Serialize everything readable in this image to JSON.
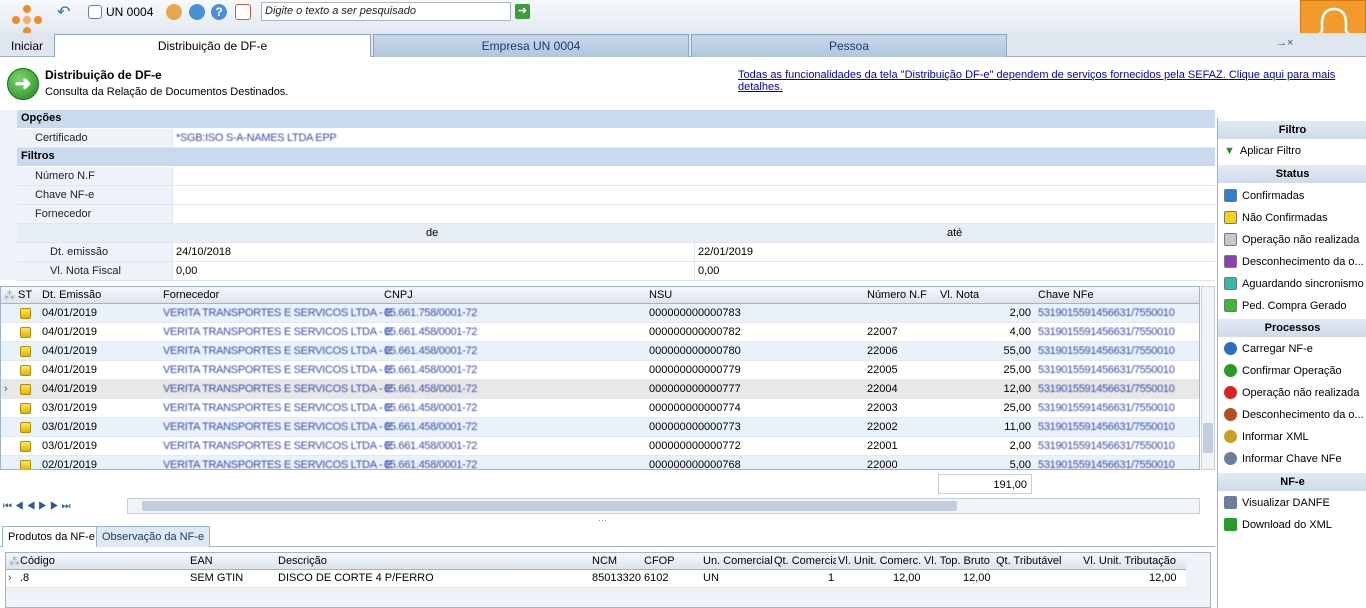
{
  "toolbar": {
    "unit_label": "UN 0004",
    "search_placeholder": "Digite o texto a ser pesquisado",
    "start_label": "Iniciar"
  },
  "tabs": [
    {
      "label": "Distribuição de DF-e",
      "active": true
    },
    {
      "label": "Empresa UN 0004",
      "active": false
    },
    {
      "label": "Pessoa",
      "active": false
    }
  ],
  "tabs_close": "→×",
  "header": {
    "title": "Distribuição de DF-e",
    "subtitle": "Consulta da Relação de Documentos Destinados.",
    "sefaz_link": "Todas as funcionalidades da tela \"Distribuição DF-e\" dependem de serviços fornecidos pela SEFAZ. Clique aqui para mais detalhes."
  },
  "options": {
    "section": "Opções",
    "cert_label": "Certificado",
    "cert_value": "*SGB:ISO S-A-NAMES LTDA EPP"
  },
  "filters": {
    "section": "Filtros",
    "nf_label": "Número N.F",
    "key_label": "Chave NF-e",
    "supplier_label": "Fornecedor",
    "from": "de",
    "to": "até",
    "date_label": "Dt. emissão",
    "date_from": "24/10/2018",
    "date_to": "22/01/2019",
    "value_label": "Vl. Nota Fiscal",
    "value_from": "0,00",
    "value_to": "0,00"
  },
  "grid": {
    "headers": [
      "ST",
      "Dt. Emissão",
      "Fornecedor",
      "CNPJ",
      "NSU",
      "Número N.F",
      "Vl. Nota",
      "Chave NFe"
    ],
    "rows": [
      {
        "date": "04/01/2019",
        "supplier": "VERITA TRANSPORTES E SERVICOS LTDA - E",
        "cnpj": "05.661.758/0001-72",
        "nsu": "000000000000783",
        "nf": "",
        "value": "2,00",
        "key": "5319015591456631/7550010"
      },
      {
        "date": "04/01/2019",
        "supplier": "VERITA TRANSPORTES E SERVICOS LTDA - E",
        "cnpj": "05.661.458/0001-72",
        "nsu": "000000000000782",
        "nf": "22007",
        "value": "4,00",
        "key": "5319015591456631/7550010"
      },
      {
        "date": "04/01/2019",
        "supplier": "VERITA TRANSPORTES E SERVICOS LTDA - E",
        "cnpj": "05.661.458/0001-72",
        "nsu": "000000000000780",
        "nf": "22006",
        "value": "55,00",
        "key": "5319015591456631/7550010"
      },
      {
        "date": "04/01/2019",
        "supplier": "VERITA TRANSPORTES E SERVICOS LTDA - E",
        "cnpj": "05.661.458/0001-72",
        "nsu": "000000000000779",
        "nf": "22005",
        "value": "25,00",
        "key": "5319015591456631/7550010"
      },
      {
        "date": "04/01/2019",
        "supplier": "VERITA TRANSPORTES E SERVICOS LTDA - E",
        "cnpj": "05.661.458/0001-72",
        "nsu": "000000000000777",
        "nf": "22004",
        "value": "12,00",
        "key": "5319015591456631/7550010"
      },
      {
        "date": "03/01/2019",
        "supplier": "VERITA TRANSPORTES E SERVICOS LTDA - E",
        "cnpj": "05.661.458/0001-72",
        "nsu": "000000000000774",
        "nf": "22003",
        "value": "25,00",
        "key": "5319015591456631/7550010"
      },
      {
        "date": "03/01/2019",
        "supplier": "VERITA TRANSPORTES E SERVICOS LTDA - E",
        "cnpj": "05.661.458/0001-72",
        "nsu": "000000000000773",
        "nf": "22002",
        "value": "11,00",
        "key": "5319015591456631/7550010"
      },
      {
        "date": "03/01/2019",
        "supplier": "VERITA TRANSPORTES E SERVICOS LTDA - E",
        "cnpj": "05.661.458/0001-72",
        "nsu": "000000000000772",
        "nf": "22001",
        "value": "2,00",
        "key": "5319015591456631/7550010"
      },
      {
        "date": "02/01/2019",
        "supplier": "VERITA TRANSPORTES E SERVICOS LTDA - E",
        "cnpj": "05.661.458/0001-72",
        "nsu": "000000000000768",
        "nf": "22000",
        "value": "5,00",
        "key": "5319015591456631/7550010"
      }
    ],
    "total": "191,00"
  },
  "side": {
    "filtro": "Filtro",
    "apply": "Aplicar Filtro",
    "status": "Status",
    "status_items": [
      {
        "label": "Confirmadas",
        "color": "#2f7fd6"
      },
      {
        "label": "Não Confirmadas",
        "color": "#f2d21a"
      },
      {
        "label": "Operação não realizada",
        "color": "#c8c8c8"
      },
      {
        "label": "Desconhecimento da o...",
        "color": "#8e3fb0"
      },
      {
        "label": "Aguardando sincronismo",
        "color": "#35b8a6"
      },
      {
        "label": "Ped. Compra Gerado",
        "color": "#3fb83a"
      }
    ],
    "processos": "Processos",
    "process_items": [
      "Carregar NF-e",
      "Confirmar Operação",
      "Operação não realizada",
      "Desconhecimento da o...",
      "Informar XML",
      "Informar Chave NFe"
    ],
    "nfe": "NF-e",
    "nfe_items": [
      "Visualizar DANFE",
      "Download do XML"
    ]
  },
  "bottom": {
    "tabs": [
      "Produtos da NF-e",
      "Observação da NF-e"
    ],
    "headers": [
      "Código",
      "EAN",
      "Descrição",
      "NCM",
      "CFOP",
      "Un. Comercial",
      "Qt. Comercial",
      "Vl. Unit. Comerc.",
      "Vl. Top. Bruto",
      "Qt. Tributável",
      "Vl. Unit. Tributação"
    ],
    "row": {
      "codigo": ".8",
      "ean": "SEM GTIN",
      "descricao": "DISCO DE CORTE 4 P/FERRO",
      "ncm": "85013320",
      "cfop": "6102",
      "un": "UN",
      "qt": "1",
      "vl_unit": "12,00",
      "vl_bruto": "12,00",
      "qt_trib": "",
      "vl_trib": "12,00"
    }
  }
}
